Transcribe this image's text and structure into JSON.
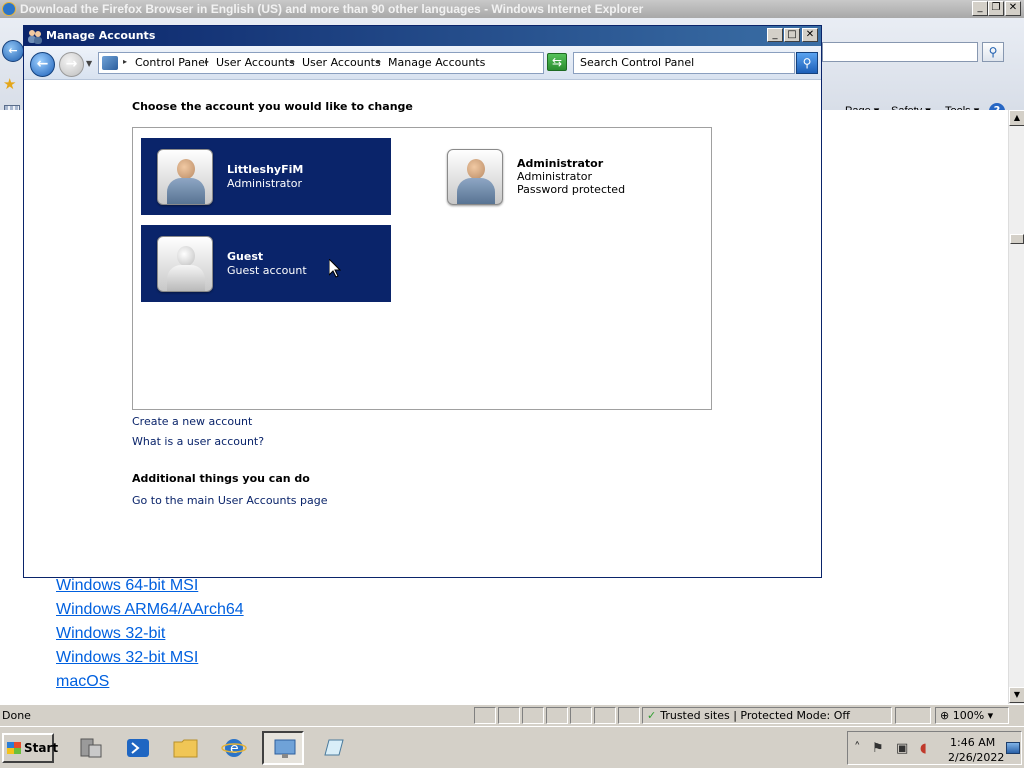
{
  "ie": {
    "title": "Download the Firefox Browser in English (US) and more than 90 other languages - Windows Internet Explorer",
    "commands": [
      "Page",
      "Safety",
      "Tools"
    ],
    "page_links": [
      "Windows 64-bit MSI",
      "Windows ARM64/AArch64",
      "Windows 32-bit",
      "Windows 32-bit MSI",
      "macOS"
    ],
    "status": {
      "text": "Done",
      "zone": "Trusted sites | Protected Mode: Off",
      "zoom": "100%"
    }
  },
  "window": {
    "title": "Manage Accounts",
    "breadcrumbs": [
      "Control Panel",
      "User Accounts",
      "User Accounts",
      "Manage Accounts"
    ],
    "search_placeholder": "Search Control Panel"
  },
  "main": {
    "heading": "Choose the account you would like to change",
    "accounts": [
      {
        "name": "LittleshyFiM",
        "type": "Administrator",
        "extra": "",
        "selected": true
      },
      {
        "name": "Administrator",
        "type": "Administrator",
        "extra": "Password protected",
        "selected": false
      },
      {
        "name": "Guest",
        "type": "Guest account",
        "extra": "",
        "selected": true
      }
    ],
    "links": [
      "Create a new account",
      "What is a user account?"
    ],
    "additional_heading": "Additional things you can do",
    "additional_links": [
      "Go to the main User Accounts page"
    ]
  },
  "taskbar": {
    "start_label": "Start",
    "clock_time": "1:46 AM",
    "clock_date": "2/26/2022"
  }
}
